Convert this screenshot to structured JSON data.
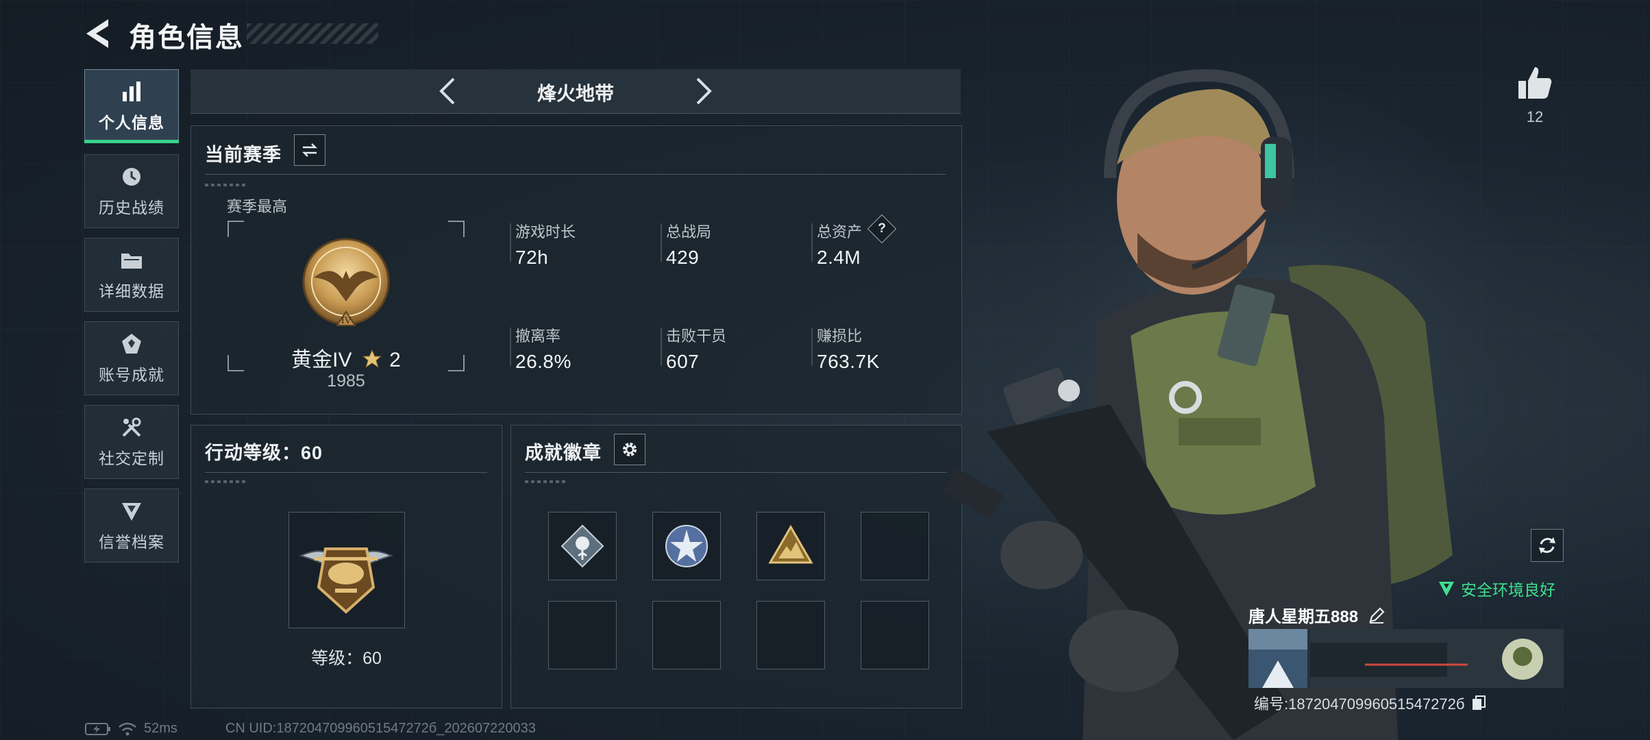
{
  "header": {
    "title": "角色信息"
  },
  "sidebar": {
    "items": [
      {
        "label": "个人信息",
        "icon": "bar-chart-icon",
        "active": true
      },
      {
        "label": "历史战绩",
        "icon": "history-icon"
      },
      {
        "label": "详细数据",
        "icon": "folder-icon"
      },
      {
        "label": "账号成就",
        "icon": "achievement-icon"
      },
      {
        "label": "社交定制",
        "icon": "tools-icon"
      },
      {
        "label": "信誉档案",
        "icon": "shield-icon"
      }
    ]
  },
  "mode": {
    "name": "烽火地带"
  },
  "season": {
    "title": "当前赛季",
    "best_label": "赛季最高",
    "rank_name": "黄金IV",
    "rank_stars": "2",
    "rank_points": "1985",
    "stats": [
      {
        "label": "游戏时长",
        "value": "72h"
      },
      {
        "label": "总战局",
        "value": "429"
      },
      {
        "label": "总资产",
        "value": "2.4M",
        "help": "?"
      },
      {
        "label": "撤离率",
        "value": "26.8%"
      },
      {
        "label": "击败干员",
        "value": "607"
      },
      {
        "label": "赚损比",
        "value": "763.7K"
      }
    ]
  },
  "level": {
    "title": "行动等级：60",
    "level_text": "等级：60"
  },
  "badges": {
    "title": "成就徽章"
  },
  "profile": {
    "likes": "12",
    "safe_status": "安全环境良好",
    "nickname": "唐人星期五888",
    "uid_text": "编号:18720470996051547272б"
  },
  "footer": {
    "ping": "52ms",
    "uid_line": "CN UID:18720470996051547272б_202607220033"
  },
  "colors": {
    "accent_green": "#3ad38a",
    "safe_green": "#3fe08f",
    "panel_bg": "#1c262e"
  }
}
